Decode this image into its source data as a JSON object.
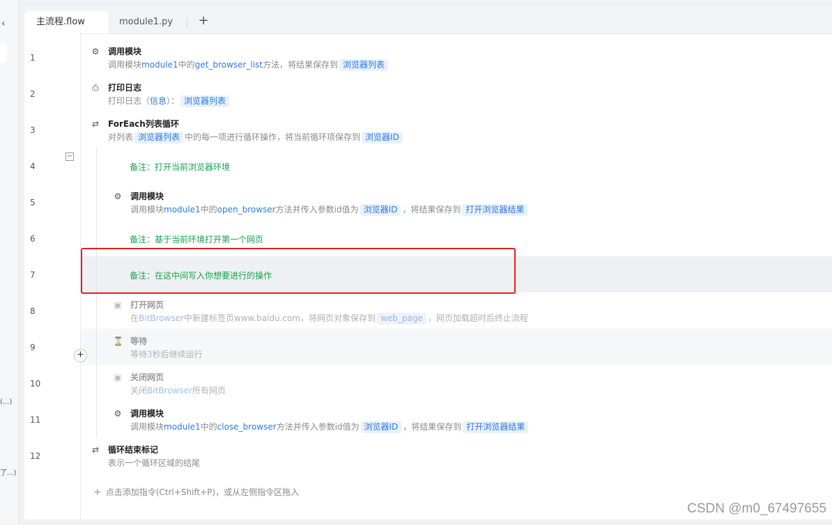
{
  "sidebar": {
    "collapse_icon": "chevron-left-icon",
    "trunc_1": "(...)",
    "trunc_2": "了...)"
  },
  "tabs": [
    {
      "label": "主流程.flow",
      "active": true
    },
    {
      "label": "module1.py",
      "active": false
    }
  ],
  "add_tab_symbol": "+",
  "fold_symbol": "−",
  "gutter_plus_symbol": "+",
  "lines": [
    "1",
    "2",
    "3",
    "4",
    "5",
    "6",
    "7",
    "8",
    "9",
    "10",
    "11",
    "12"
  ],
  "statements": {
    "s1": {
      "title": "调用模块",
      "p1": "调用模块",
      "h1": "module1",
      "p2": "中的",
      "h2": "get_browser_list",
      "p3": "方法，将结果保存到",
      "t1": "浏览器列表",
      "icon": "module-call-icon"
    },
    "s2": {
      "title": "打印日志",
      "p1": "打印日志（",
      "h1": "信息",
      "p2": "）：",
      "t1": "浏览器列表",
      "icon": "printer-icon"
    },
    "s3": {
      "title": "ForEach列表循环",
      "p1": "对列表",
      "t1": "浏览器列表",
      "p2": "中的每一项进行循环操作，将当前循环项保存到",
      "t2": "浏览器ID",
      "icon": "loop-icon"
    },
    "c4": "备注：打开当前浏览器环境",
    "s5": {
      "title": "调用模块",
      "p1": "调用模块",
      "h1": "module1",
      "p2": "中的",
      "h2": "open_browser",
      "p3": "方法并传入参数id值为",
      "t1": "浏览器ID",
      "p4": "，将结果保存到",
      "t2": "打开浏览器结果",
      "icon": "module-call-icon"
    },
    "c6": "备注：基于当前环境打开第一个网页",
    "c7": "备注：在这中间写入你想要进行的操作",
    "s8": {
      "title": "打开网页",
      "p1": "在",
      "h1": "BitBrowser",
      "p2": "中新建标签页www.baidu.com，将网页对象保存到",
      "t1": "web_page",
      "p3": "，网页加载超时后终止流程",
      "icon": "browser-window-icon"
    },
    "s9": {
      "title": "等待",
      "p1": "等待",
      "h1": "3",
      "p2": "秒后继续运行",
      "icon": "hourglass-icon"
    },
    "s10": {
      "title": "关闭网页",
      "p1": "关闭",
      "h1": "BitBrowser",
      "p2": "所有网页",
      "icon": "browser-window-icon"
    },
    "s11": {
      "title": "调用模块",
      "p1": "调用模块",
      "h1": "module1",
      "p2": "中的",
      "h2": "close_browser",
      "p3": "方法并传入参数id值为",
      "t1": "浏览器ID",
      "p4": "，将结果保存到",
      "t2": "打开浏览器结果",
      "icon": "module-call-icon"
    },
    "s12": {
      "title": "循环结束标记",
      "p1": "表示一个循环区域的结尾",
      "icon": "loop-end-icon"
    }
  },
  "add_instruction": "点击添加指令(Ctrl+Shift+P)，或从左侧指令区拖入",
  "watermark": "CSDN @m0_67497655",
  "colors": {
    "highlight": "#2e7ae0",
    "comment": "#14a44d",
    "annotation_box": "#e02020"
  }
}
